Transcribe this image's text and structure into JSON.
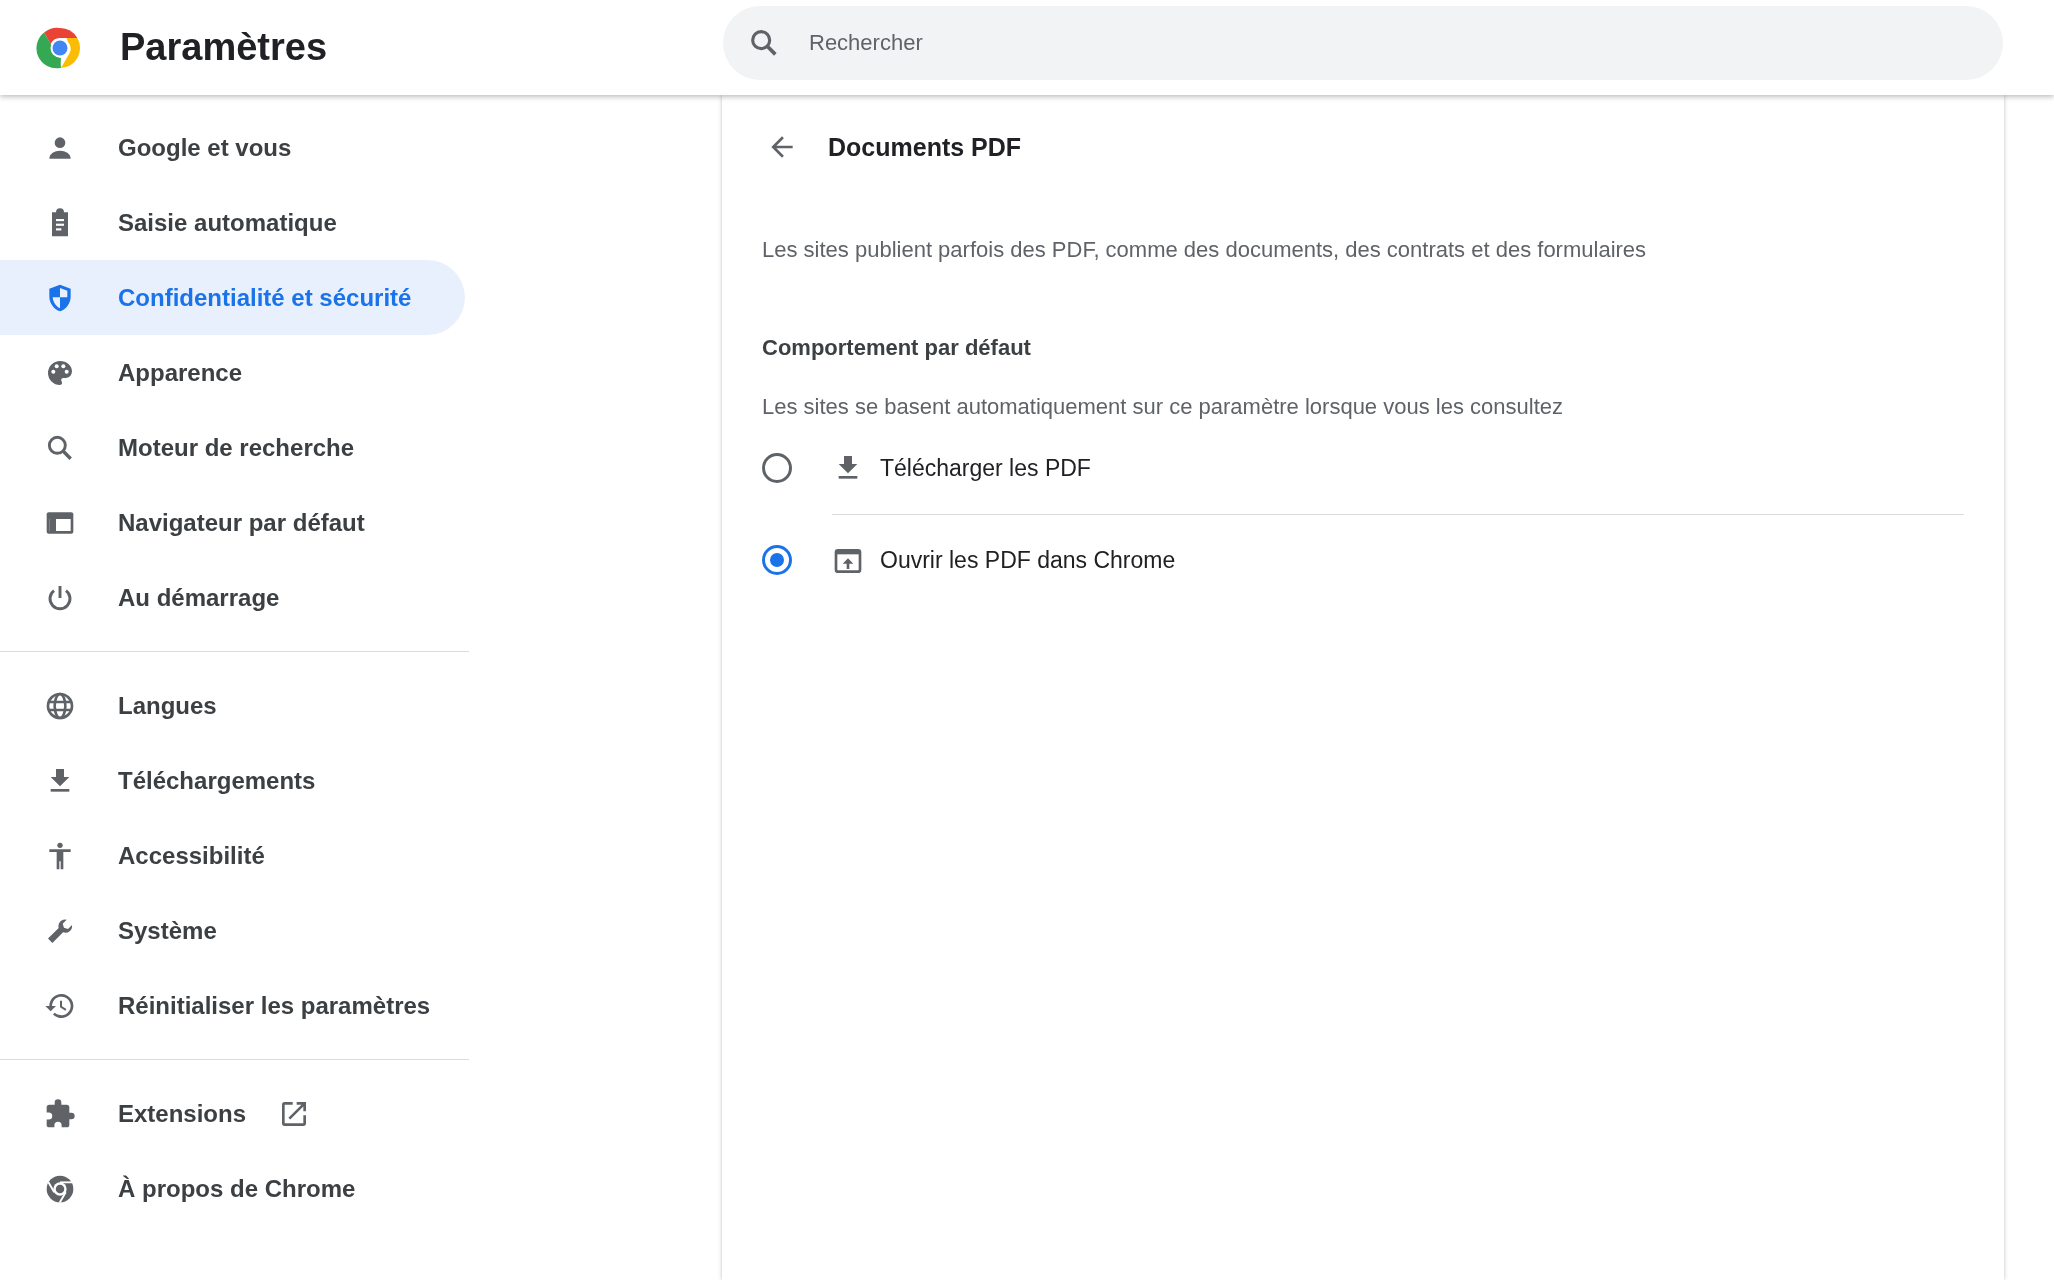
{
  "header": {
    "title": "Paramètres",
    "search": {
      "placeholder": "Rechercher"
    }
  },
  "sidebar": {
    "groups": [
      {
        "items": [
          {
            "label": "Google et vous",
            "selected": false
          },
          {
            "label": "Saisie automatique",
            "selected": false
          },
          {
            "label": "Confidentialité et sécurité",
            "selected": true
          },
          {
            "label": "Apparence",
            "selected": false
          },
          {
            "label": "Moteur de recherche",
            "selected": false
          },
          {
            "label": "Navigateur par défaut",
            "selected": false
          },
          {
            "label": "Au démarrage",
            "selected": false
          }
        ]
      },
      {
        "items": [
          {
            "label": "Langues",
            "selected": false
          },
          {
            "label": "Téléchargements",
            "selected": false
          },
          {
            "label": "Accessibilité",
            "selected": false
          },
          {
            "label": "Système",
            "selected": false
          },
          {
            "label": "Réinitialiser les paramètres",
            "selected": false
          }
        ]
      },
      {
        "items": [
          {
            "label": "Extensions",
            "selected": false,
            "external": true
          },
          {
            "label": "À propos de Chrome",
            "selected": false
          }
        ]
      }
    ]
  },
  "page": {
    "title": "Documents PDF",
    "description": "Les sites publient parfois des PDF, comme des documents, des contrats et des formulaires",
    "section": {
      "title": "Comportement par défaut",
      "description": "Les sites se basent automatiquement sur ce paramètre lorsque vous les consultez",
      "options": [
        {
          "label": "Télécharger les PDF",
          "selected": false
        },
        {
          "label": "Ouvrir les PDF dans Chrome",
          "selected": true
        }
      ]
    }
  }
}
